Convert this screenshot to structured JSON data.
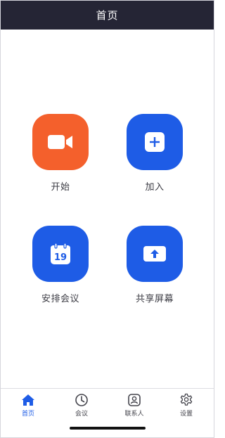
{
  "header": {
    "title": "首页"
  },
  "actions": {
    "start": {
      "label": "开始",
      "color": "#f4602c",
      "icon": "video-camera-icon"
    },
    "join": {
      "label": "加入",
      "color": "#1e5ce6",
      "icon": "plus-icon"
    },
    "schedule": {
      "label": "安排会议",
      "color": "#1e5ce6",
      "icon": "calendar-icon",
      "day": "19"
    },
    "share": {
      "label": "共享屏幕",
      "color": "#1e5ce6",
      "icon": "share-screen-icon"
    }
  },
  "tabs": [
    {
      "label": "首页",
      "icon": "home-icon",
      "active": true
    },
    {
      "label": "会议",
      "icon": "clock-icon",
      "active": false
    },
    {
      "label": "联系人",
      "icon": "contact-icon",
      "active": false
    },
    {
      "label": "设置",
      "icon": "gear-icon",
      "active": false
    }
  ],
  "colors": {
    "header_bg": "#252535",
    "accent": "#1e5ce6",
    "start_orange": "#f4602c"
  }
}
